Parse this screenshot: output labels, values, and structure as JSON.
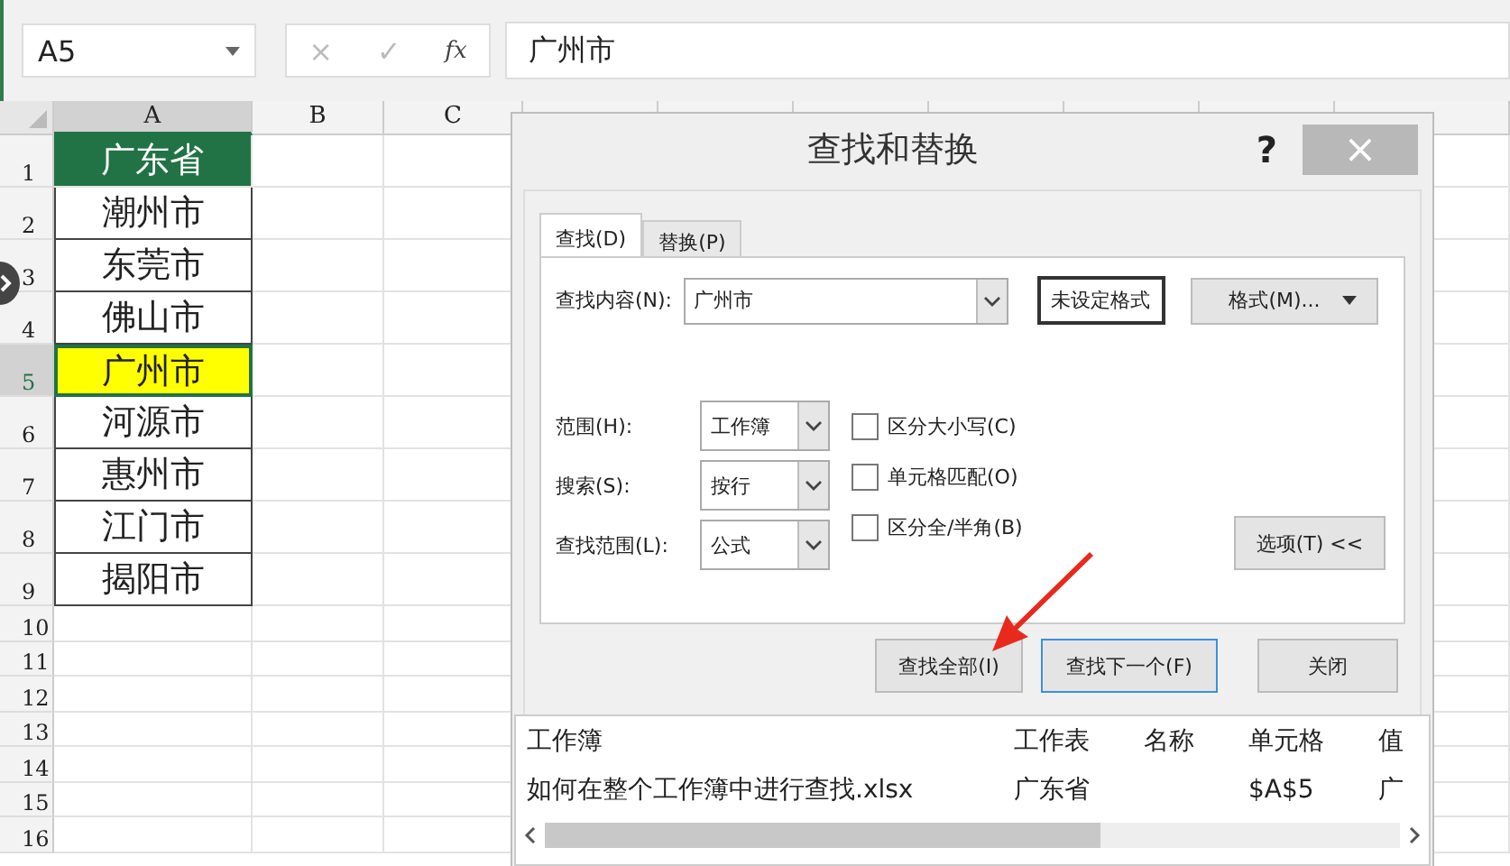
{
  "formula_bar": {
    "name_box": "A5",
    "cancel": "×",
    "enter": "✓",
    "function": "fx",
    "value": "广州市"
  },
  "sheet": {
    "columns": [
      "A",
      "B",
      "C"
    ],
    "rows": [
      {
        "number": "1",
        "kind": "header",
        "cell": "广东省",
        "selected": false
      },
      {
        "number": "2",
        "kind": "data",
        "cell": "潮州市",
        "selected": false
      },
      {
        "number": "3",
        "kind": "data",
        "cell": "东莞市",
        "selected": false
      },
      {
        "number": "4",
        "kind": "data",
        "cell": "佛山市",
        "selected": false
      },
      {
        "number": "5",
        "kind": "data",
        "cell": "广州市",
        "selected": true
      },
      {
        "number": "6",
        "kind": "data",
        "cell": "河源市",
        "selected": false
      },
      {
        "number": "7",
        "kind": "data",
        "cell": "惠州市",
        "selected": false
      },
      {
        "number": "8",
        "kind": "data",
        "cell": "江门市",
        "selected": false
      },
      {
        "number": "9",
        "kind": "data",
        "cell": "揭阳市",
        "selected": false
      },
      {
        "number": "10",
        "kind": "empty"
      },
      {
        "number": "11",
        "kind": "empty"
      },
      {
        "number": "12",
        "kind": "empty"
      },
      {
        "number": "13",
        "kind": "empty"
      },
      {
        "number": "14",
        "kind": "empty"
      },
      {
        "number": "15",
        "kind": "empty"
      },
      {
        "number": "16",
        "kind": "empty"
      }
    ]
  },
  "dialog": {
    "title": "查找和替换",
    "help": "?",
    "close": "×",
    "tabs": [
      {
        "label": "查找(D)",
        "selected": true
      },
      {
        "label": "替换(P)",
        "selected": false
      }
    ],
    "find_what": {
      "label": "查找内容(N):",
      "value": "广州市"
    },
    "format_status": "未设定格式",
    "format_button": "格式(M)...",
    "selects": [
      {
        "label": "范围(H):",
        "value": "工作簿"
      },
      {
        "label": "搜索(S):",
        "value": "按行"
      },
      {
        "label": "查找范围(L):",
        "value": "公式"
      }
    ],
    "checkboxes": [
      {
        "label": "区分大小写(C)",
        "checked": false
      },
      {
        "label": "单元格匹配(O)",
        "checked": false
      },
      {
        "label": "区分全/半角(B)",
        "checked": false
      }
    ],
    "options_button": "选项(T) <<",
    "buttons": [
      {
        "label": "查找全部(I)",
        "selected": false
      },
      {
        "label": "查找下一个(F)",
        "selected": true
      },
      {
        "label": "关闭",
        "selected": false
      }
    ],
    "results": {
      "columns": [
        "工作簿",
        "工作表",
        "名称",
        "单元格",
        "值"
      ],
      "rows": [
        [
          "如何在整个工作簿中进行查找.xlsx",
          "广东省",
          "",
          "$A$5",
          "广"
        ]
      ]
    }
  }
}
